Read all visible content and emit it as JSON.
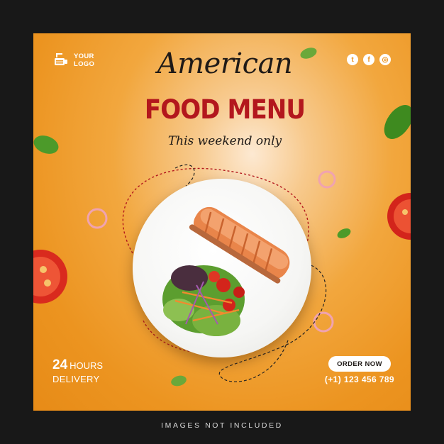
{
  "logo": {
    "line1": "YOUR",
    "line2": "LOGO"
  },
  "social": [
    {
      "icon": "twitter-icon",
      "glyph": "t"
    },
    {
      "icon": "facebook-icon",
      "glyph": "f"
    },
    {
      "icon": "instagram-icon",
      "glyph": "◎"
    }
  ],
  "headline": {
    "script": "American",
    "main": "FOOD MENU",
    "sub": "This weekend only"
  },
  "delivery": {
    "number": "24",
    "unit": "HOURS",
    "label": "DELIVERY"
  },
  "cta": {
    "label": "ORDER NOW"
  },
  "contact": {
    "phone": "(+1) 123 456 789"
  },
  "footer": {
    "text": "IMAGES NOT INCLUDED"
  },
  "colors": {
    "background": "#181818",
    "accent_orange": "#ec9420",
    "title_red": "#b3171d",
    "text_dark": "#1f1a17"
  },
  "image": {
    "subject": "plate of grilled salmon with mixed salad"
  }
}
